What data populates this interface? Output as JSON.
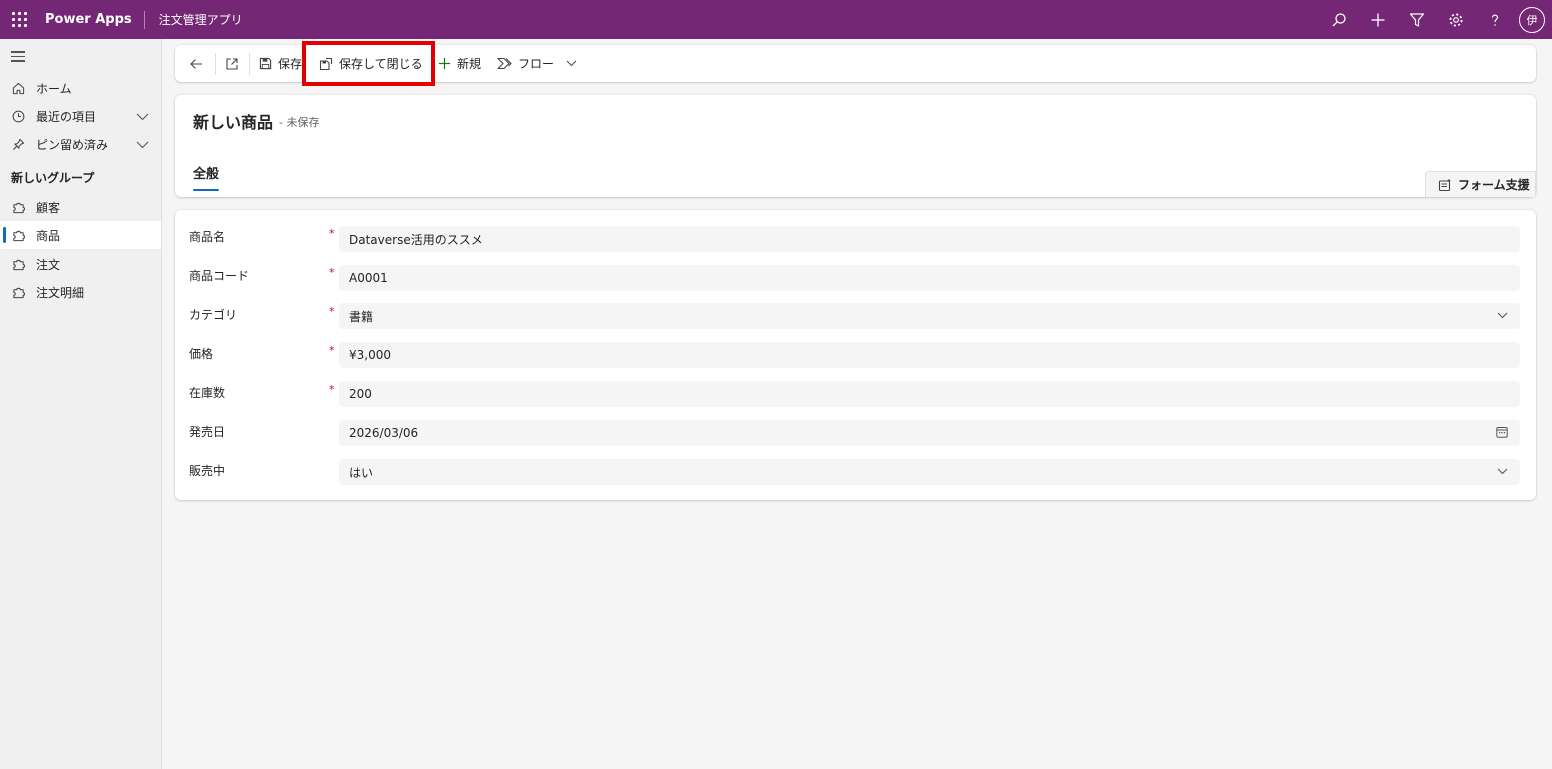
{
  "topbar": {
    "brand": "Power Apps",
    "app_name": "注文管理アプリ",
    "avatar_initial": "伊",
    "accent_color": "#742774"
  },
  "sidebar": {
    "items": [
      {
        "label": "ホーム",
        "icon": "home-icon"
      },
      {
        "label": "最近の項目",
        "icon": "clock-icon",
        "expandable": true
      },
      {
        "label": "ピン留め済み",
        "icon": "pin-icon",
        "expandable": true
      }
    ],
    "group_title": "新しいグループ",
    "group_items": [
      {
        "label": "顧客",
        "icon": "puzzle-icon"
      },
      {
        "label": "商品",
        "icon": "puzzle-icon",
        "selected": true
      },
      {
        "label": "注文",
        "icon": "puzzle-icon"
      },
      {
        "label": "注文明細",
        "icon": "puzzle-icon"
      }
    ]
  },
  "commandbar": {
    "save": "保存",
    "save_and_close": "保存して閉じる",
    "new": "新規",
    "flow": "フロー"
  },
  "record": {
    "title": "新しい商品",
    "status": "- 未保存",
    "tab": "全般",
    "form_assist": "フォーム支援"
  },
  "form": {
    "fields": [
      {
        "label": "商品名",
        "value": "Dataverse活用のススメ",
        "required": true
      },
      {
        "label": "商品コード",
        "value": "A0001",
        "required": true
      },
      {
        "label": "カテゴリ",
        "value": "書籍",
        "required": true,
        "type": "select"
      },
      {
        "label": "価格",
        "value": "¥3,000",
        "required": true
      },
      {
        "label": "在庫数",
        "value": "200",
        "required": true
      },
      {
        "label": "発売日",
        "value": "2026/03/06",
        "required": false,
        "type": "date"
      },
      {
        "label": "販売中",
        "value": "はい",
        "required": false,
        "type": "select"
      }
    ],
    "required_marker": "*"
  }
}
